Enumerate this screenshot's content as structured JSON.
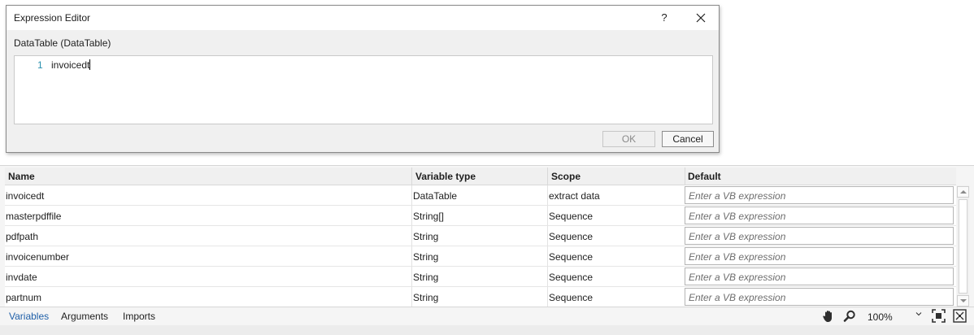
{
  "dialog": {
    "title": "Expression Editor",
    "help_label": "?",
    "close_label": "✕",
    "field_label": "DataTable (DataTable)",
    "editor": {
      "line_number": "1",
      "code": "invoicedt"
    },
    "ok_label": "OK",
    "cancel_label": "Cancel"
  },
  "variables": {
    "columns": {
      "name": "Name",
      "type": "Variable type",
      "scope": "Scope",
      "default": "Default"
    },
    "placeholder": "Enter a VB expression",
    "rows": [
      {
        "name": "invoicedt",
        "type": "DataTable",
        "scope": "extract data"
      },
      {
        "name": "masterpdffile",
        "type": "String[]",
        "scope": "Sequence"
      },
      {
        "name": "pdfpath",
        "type": "String",
        "scope": "Sequence"
      },
      {
        "name": "invoicenumber",
        "type": "String",
        "scope": "Sequence"
      },
      {
        "name": "invdate",
        "type": "String",
        "scope": "Sequence"
      },
      {
        "name": "partnum",
        "type": "String",
        "scope": "Sequence"
      }
    ]
  },
  "bottombar": {
    "tabs": [
      "Variables",
      "Arguments",
      "Imports"
    ],
    "active_tab": "Variables",
    "zoom": "100%",
    "icons": [
      "hand-icon",
      "zoom-icon",
      "fit-to-screen-icon",
      "overview-icon"
    ]
  },
  "colors": {
    "accent": "#1f5fa8",
    "line_number": "#2b91af",
    "placeholder": "#6d6d6d"
  }
}
